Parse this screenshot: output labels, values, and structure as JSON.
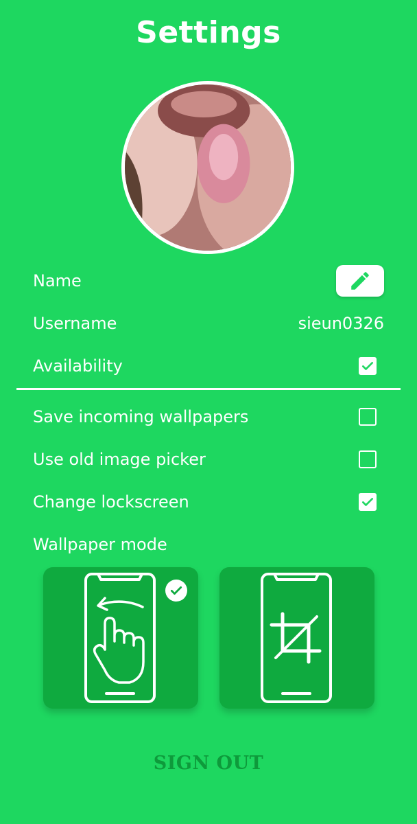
{
  "header": {
    "title": "Settings"
  },
  "profile": {
    "avatar_alt": "profile photo"
  },
  "rows": {
    "name": {
      "label": "Name"
    },
    "username": {
      "label": "Username",
      "value": "sieun0326"
    },
    "availability": {
      "label": "Availability",
      "checked": true
    },
    "save_wallpapers": {
      "label": "Save incoming wallpapers",
      "checked": false
    },
    "old_picker": {
      "label": "Use old image picker",
      "checked": false
    },
    "lockscreen": {
      "label": "Change lockscreen",
      "checked": true
    },
    "wallpaper_mode": {
      "label": "Wallpaper mode"
    }
  },
  "modes": [
    {
      "icon": "phone-swipe-icon",
      "selected": true
    },
    {
      "icon": "phone-crop-icon",
      "selected": false
    }
  ],
  "footer": {
    "sign_out": "SIGN OUT"
  },
  "colors": {
    "background": "#1ed760",
    "card": "#0faa3f",
    "sign_out": "#0e9a3b",
    "icon": "#1ed760"
  }
}
